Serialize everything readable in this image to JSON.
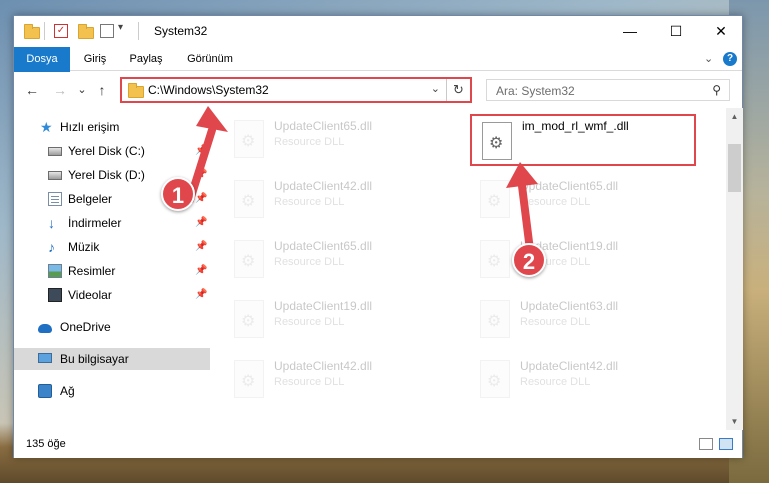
{
  "window": {
    "title": "System32",
    "controls": {
      "minimize": "—",
      "maximize": "☐",
      "close": "✕"
    }
  },
  "ribbon": {
    "tabs": [
      "Dosya",
      "Giriş",
      "Paylaş",
      "Görünüm"
    ],
    "expand_chevron": "⌄",
    "help": "?"
  },
  "nav": {
    "back": "←",
    "forward": "→",
    "recent": "⌄",
    "up": "↑",
    "address": "C:\\Windows\\System32",
    "address_chevron": "⌄",
    "refresh": "↻",
    "search_placeholder": "Ara: System32",
    "search_icon": "⚲"
  },
  "sidebar": {
    "items": [
      {
        "label": "Hızlı erişim",
        "icon": "star-icon",
        "pinned": false
      },
      {
        "label": "Yerel Disk (C:)",
        "icon": "drive-icon",
        "pinned": true
      },
      {
        "label": "Yerel Disk (D:)",
        "icon": "drive-icon",
        "pinned": true
      },
      {
        "label": "Belgeler",
        "icon": "documents-icon",
        "pinned": true
      },
      {
        "label": "İndirmeler",
        "icon": "downloads-icon",
        "pinned": true
      },
      {
        "label": "Müzik",
        "icon": "music-icon",
        "pinned": true
      },
      {
        "label": "Resimler",
        "icon": "pictures-icon",
        "pinned": true
      },
      {
        "label": "Videolar",
        "icon": "videos-icon",
        "pinned": true
      },
      {
        "label": "OneDrive",
        "icon": "onedrive-icon",
        "pinned": false
      },
      {
        "label": "Bu bilgisayar",
        "icon": "this-pc-icon",
        "pinned": false,
        "selected": true
      },
      {
        "label": "Ağ",
        "icon": "network-icon",
        "pinned": false
      }
    ],
    "pin_glyph": "📌"
  },
  "files": {
    "left_column": [
      {
        "name": "UpdateClient65.dll",
        "type": "Resource DLL"
      },
      {
        "name": "UpdateClient42.dll",
        "type": "Resource DLL"
      },
      {
        "name": "UpdateClient65.dll",
        "type": "Resource DLL"
      },
      {
        "name": "UpdateClient19.dll",
        "type": "Resource DLL"
      },
      {
        "name": "UpdateClient42.dll",
        "type": "Resource DLL"
      }
    ],
    "target": {
      "name": "im_mod_rl_wmf_.dll",
      "type": ""
    },
    "right_column": [
      {
        "name": "UpdateClient65.dll",
        "type": "Resource DLL"
      },
      {
        "name": "UpdateClient19.dll",
        "type": "Resource DLL"
      },
      {
        "name": "UpdateClient63.dll",
        "type": "Resource DLL"
      },
      {
        "name": "UpdateClient42.dll",
        "type": "Resource DLL"
      }
    ]
  },
  "status": {
    "item_count": "135 öğe"
  },
  "callouts": {
    "step1": "1",
    "step2": "2",
    "color": "#e0474c"
  }
}
